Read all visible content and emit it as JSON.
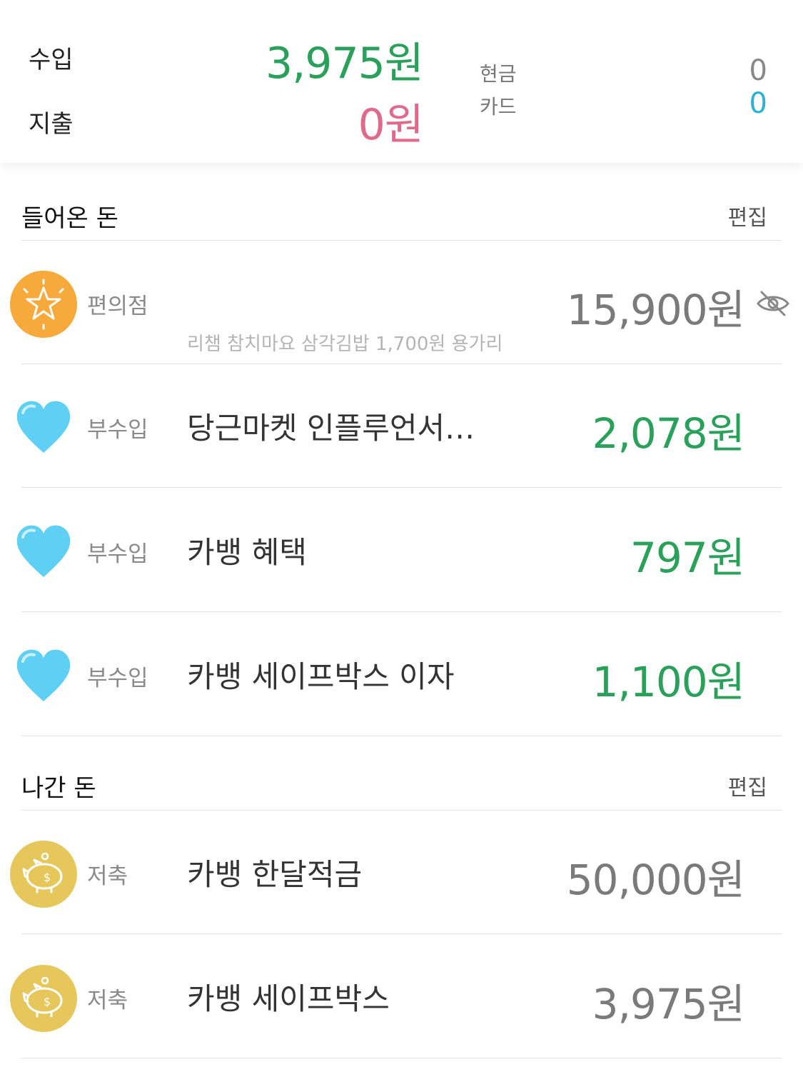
{
  "summary": {
    "income_label": "수입",
    "income_amount": "3,975원",
    "expense_label": "지출",
    "expense_amount": "0원",
    "cash_label": "현금",
    "cash_value": "0",
    "card_label": "카드",
    "card_value": "0"
  },
  "income_section": {
    "title": "들어온 돈",
    "edit_label": "편집",
    "items": [
      {
        "icon": "star-icon",
        "category": "편의점",
        "memo": "",
        "amount": "15,900원",
        "note": "리챔 참치마요 삼각김밥 1,700원 용가리",
        "hidden": true
      },
      {
        "icon": "blue-heart-icon",
        "category": "부수입",
        "memo": "당근마켓 인플루언서…",
        "amount": "2,078원"
      },
      {
        "icon": "blue-heart-icon",
        "category": "부수입",
        "memo": "카뱅 혜택",
        "amount": "797원"
      },
      {
        "icon": "blue-heart-icon",
        "category": "부수입",
        "memo": "카뱅 세이프박스 이자",
        "amount": "1,100원"
      }
    ]
  },
  "expense_section": {
    "title": "나간 돈",
    "edit_label": "편집",
    "items": [
      {
        "icon": "piggy-bank-icon",
        "category": "저축",
        "memo": "카뱅 한달적금",
        "amount": "50,000원"
      },
      {
        "icon": "piggy-bank-icon",
        "category": "저축",
        "memo": "카뱅 세이프박스",
        "amount": "3,975원"
      }
    ]
  },
  "colors": {
    "income": "#2aa05a",
    "expense": "#e06a8c",
    "card": "#2bb0d8",
    "cash": "#888888",
    "neutral_amount": "#7a7a7a",
    "star_bg": "#f7a93b",
    "piggy_bg": "#e5c75c",
    "heart": "#5fd0f3"
  }
}
